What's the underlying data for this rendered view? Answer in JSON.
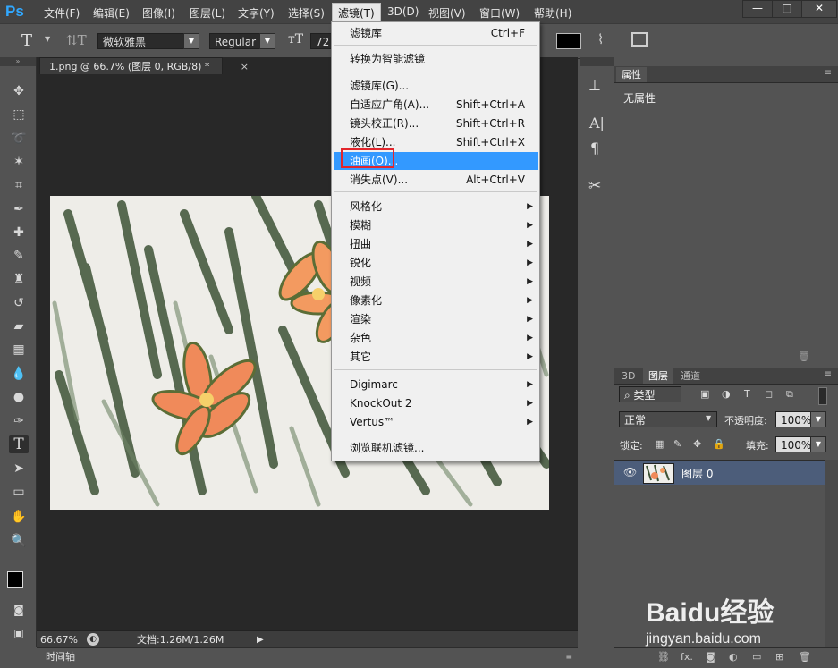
{
  "app": {
    "logo": "Ps"
  },
  "menubar": {
    "items": [
      "文件(F)",
      "编辑(E)",
      "图像(I)",
      "图层(L)",
      "文字(Y)",
      "选择(S)",
      "滤镜(T)",
      "3D(D)",
      "视图(V)",
      "窗口(W)",
      "帮助(H)"
    ],
    "active_index": 6
  },
  "window_controls": {
    "minimize": "—",
    "maximize": "□",
    "close": "✕"
  },
  "options_bar": {
    "font_family": "微软雅黑",
    "font_style": "Regular",
    "font_size": "72",
    "color_swatch": "#000000"
  },
  "document": {
    "tab_title": "1.png @ 66.7% (图层 0, RGB/8) *",
    "tab_close": "×",
    "zoom": "66.67%",
    "doc_info": "文档:1.26M/1.26M"
  },
  "timeline": {
    "label": "时间轴"
  },
  "filter_menu": {
    "items": [
      {
        "label": "滤镜库",
        "shortcut": "Ctrl+F"
      },
      {
        "label": "转换为智能滤镜",
        "shortcut": ""
      },
      {
        "label": "滤镜库(G)...",
        "shortcut": ""
      },
      {
        "label": "自适应广角(A)...",
        "shortcut": "Shift+Ctrl+A"
      },
      {
        "label": "镜头校正(R)...",
        "shortcut": "Shift+Ctrl+R"
      },
      {
        "label": "液化(L)...",
        "shortcut": "Shift+Ctrl+X"
      },
      {
        "label": "油画(O)...",
        "shortcut": ""
      },
      {
        "label": "消失点(V)...",
        "shortcut": "Alt+Ctrl+V"
      },
      {
        "label": "风格化",
        "shortcut": ""
      },
      {
        "label": "模糊",
        "shortcut": ""
      },
      {
        "label": "扭曲",
        "shortcut": ""
      },
      {
        "label": "锐化",
        "shortcut": ""
      },
      {
        "label": "视频",
        "shortcut": ""
      },
      {
        "label": "像素化",
        "shortcut": ""
      },
      {
        "label": "渲染",
        "shortcut": ""
      },
      {
        "label": "杂色",
        "shortcut": ""
      },
      {
        "label": "其它",
        "shortcut": ""
      },
      {
        "label": "Digimarc",
        "shortcut": ""
      },
      {
        "label": "KnockOut 2",
        "shortcut": ""
      },
      {
        "label": "Vertus™",
        "shortcut": ""
      },
      {
        "label": "浏览联机滤镜...",
        "shortcut": ""
      }
    ],
    "highlighted_index": 6,
    "submenu_arrow": "▶"
  },
  "properties_panel": {
    "tab": "属性",
    "content": "无属性"
  },
  "layers_panel": {
    "tabs": [
      "3D",
      "图层",
      "通道"
    ],
    "active_tab": "图层",
    "filter_kind": "类型",
    "blend_mode": "正常",
    "opacity_label": "不透明度:",
    "opacity_value": "100%",
    "lock_label": "锁定:",
    "fill_label": "填充:",
    "fill_value": "100%",
    "layers": [
      {
        "name": "图层 0"
      }
    ]
  },
  "watermark": {
    "brand": "Baidu经验",
    "url": "jingyan.baidu.com"
  },
  "colors": {
    "accent_highlight": "#3399ff",
    "callout_red": "#e2262c",
    "layer_selected": "#4c5d7a"
  }
}
